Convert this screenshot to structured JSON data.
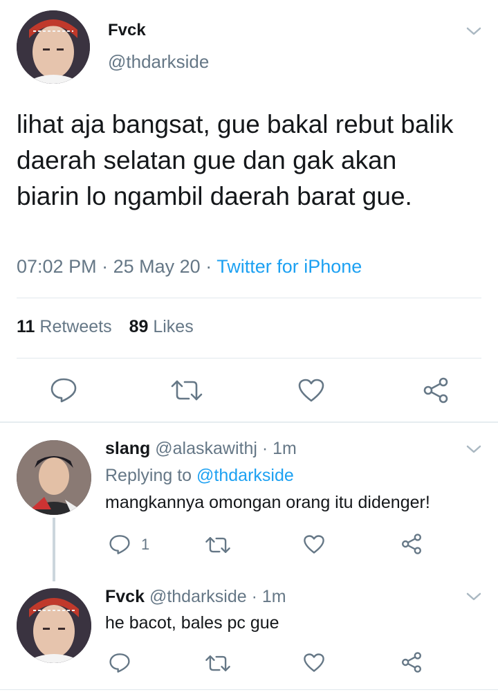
{
  "main_tweet": {
    "display_name": "Fvck",
    "handle": "@thdarkside",
    "text": "lihat aja bangsat, gue bakal rebut balik daerah selatan gue dan gak akan biarin lo ngambil daerah barat gue.",
    "time": "07:02 PM",
    "date": "25 May 20",
    "separator": "·",
    "source": "Twitter for iPhone",
    "retweets_count": "11",
    "retweets_label": "Retweets",
    "likes_count": "89",
    "likes_label": "Likes"
  },
  "replies": [
    {
      "display_name": "slang",
      "handle": "@alaskawithj",
      "separator": "·",
      "time": "1m",
      "replying_prefix": "Replying to",
      "replying_to": "@thdarkside",
      "text": "mangkannya omongan orang itu didenger!",
      "reply_count": "1"
    },
    {
      "display_name": "Fvck",
      "handle": "@thdarkside",
      "separator": "·",
      "time": "1m",
      "text": "he bacot, bales pc gue"
    }
  ],
  "icons": {
    "reply": "reply-icon",
    "retweet": "retweet-icon",
    "like": "heart-icon",
    "share": "share-icon",
    "menu": "chevron-down-icon"
  },
  "colors": {
    "accent": "#1da1f2",
    "secondary_text": "#657786",
    "primary_text": "#14171a",
    "divider": "#e1e8ed"
  }
}
